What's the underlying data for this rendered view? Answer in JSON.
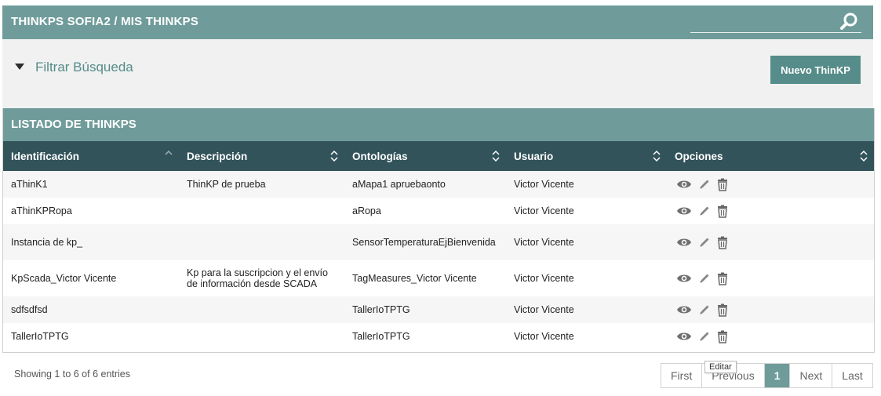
{
  "header": {
    "title": "THINKPS SOFIA2 / MIS THINKPS",
    "search_placeholder": "",
    "search_icon": "search-icon"
  },
  "filter": {
    "label": "Filtrar Búsqueda",
    "new_button": "Nuevo ThinKP"
  },
  "list": {
    "title": "LISTADO DE THINKPS",
    "columns": [
      "Identificación",
      "Descripción",
      "Ontologías",
      "Usuario",
      "Opciones"
    ],
    "rows": [
      {
        "id": "aThinK1",
        "desc": "ThinKP de prueba",
        "ont": "aMapa1 apruebaonto",
        "user": "Victor Vicente"
      },
      {
        "id": "aThinKPRopa",
        "desc": "",
        "ont": "aRopa",
        "user": "Victor Vicente"
      },
      {
        "id": "Instancia de kp_",
        "desc": "",
        "ont": "SensorTemperaturaEjBienvenida",
        "user": "Victor Vicente"
      },
      {
        "id": "KpScada_Victor Vicente",
        "desc": "Kp para la suscripcion y el envío de información desde SCADA",
        "ont": "TagMeasures_Victor Vicente",
        "user": "Victor Vicente"
      },
      {
        "id": "sdfsdfsd",
        "desc": "",
        "ont": "TallerIoTPTG",
        "user": "Victor Vicente"
      },
      {
        "id": "TallerIoTPTG",
        "desc": "",
        "ont": "TallerIoTPTG",
        "user": "Victor Vicente"
      }
    ]
  },
  "footer": {
    "info": "Showing 1 to 6 of 6 entries",
    "pager": {
      "first": "First",
      "previous": "Previous",
      "current": "1",
      "next": "Next",
      "last": "Last"
    },
    "tooltip": "Editar"
  },
  "colors": {
    "header": "#6f9c9a",
    "table_head": "#32535a",
    "button": "#568c89"
  }
}
